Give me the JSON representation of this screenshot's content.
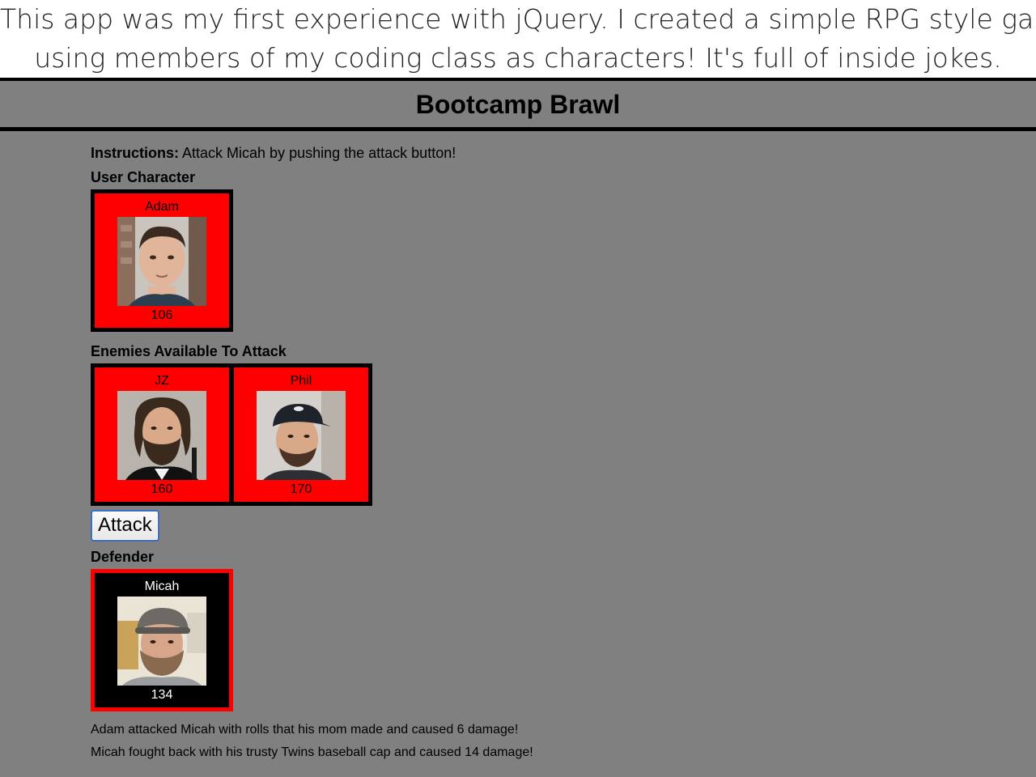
{
  "caption": {
    "line1": "This app was my first experience with jQuery.  I created a simple RPG style game",
    "line2": "using members of my coding class as characters!  It's full of inside jokes."
  },
  "app": {
    "title": "Bootcamp Brawl",
    "instructions_label": "Instructions:",
    "instructions_text": " Attack Micah by pushing the attack button!",
    "user_section_label": "User Character",
    "enemies_section_label": "Enemies Available To Attack",
    "defender_section_label": "Defender",
    "attack_button_label": "Attack"
  },
  "user_character": {
    "name": "Adam",
    "hp": "106"
  },
  "enemies": [
    {
      "name": "JZ",
      "hp": "160"
    },
    {
      "name": "Phil",
      "hp": "170"
    }
  ],
  "defender": {
    "name": "Micah",
    "hp": "134"
  },
  "log": [
    "Adam attacked Micah with rolls that his mom made and caused 6 damage!",
    "Micah fought back with his trusty Twins baseball cap and caused 14 damage!"
  ],
  "colors": {
    "background": "#808080",
    "card_red": "#ff0000",
    "card_black": "#000000",
    "button_border": "#3a6fc9"
  },
  "icons": {
    "adam_portrait": "photo-adam",
    "jz_portrait": "photo-jz",
    "phil_portrait": "photo-phil",
    "micah_portrait": "photo-micah"
  }
}
